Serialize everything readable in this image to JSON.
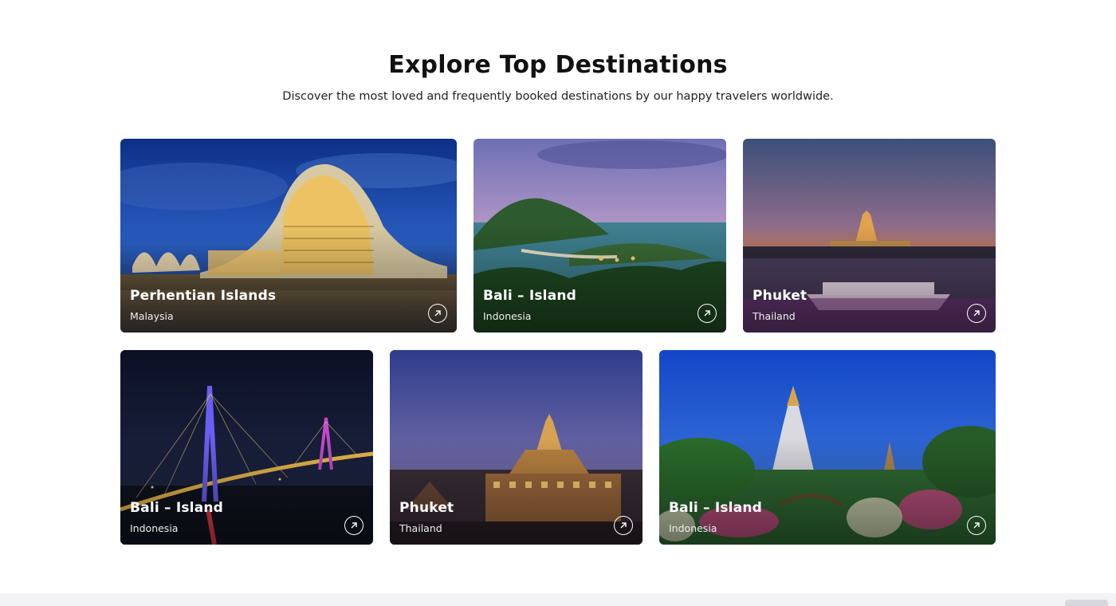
{
  "section": {
    "title": "Explore Top Destinations",
    "subtitle": "Discover the most loved and frequently booked destinations by our happy travelers worldwide."
  },
  "destinations": [
    {
      "name": "Perhentian Islands",
      "country": "Malaysia",
      "scene": "futuristic-building-dusk",
      "icon": "arrow-up-right-icon"
    },
    {
      "name": "Bali – Island",
      "country": "Indonesia",
      "scene": "island-lagoon-dusk",
      "icon": "arrow-up-right-icon"
    },
    {
      "name": "Phuket",
      "country": "Thailand",
      "scene": "temple-river-sunset",
      "icon": "arrow-up-right-icon"
    },
    {
      "name": "Bali – Island",
      "country": "Indonesia",
      "scene": "bridge-night",
      "icon": "arrow-up-right-icon"
    },
    {
      "name": "Phuket",
      "country": "Thailand",
      "scene": "palace-evening",
      "icon": "arrow-up-right-icon"
    },
    {
      "name": "Bali – Island",
      "country": "Indonesia",
      "scene": "pagoda-garden-blue-sky",
      "icon": "arrow-up-right-icon"
    }
  ],
  "colors": {
    "title": "#111111",
    "card_text": "#ffffff",
    "footer_strip": "#f3f3f5"
  }
}
